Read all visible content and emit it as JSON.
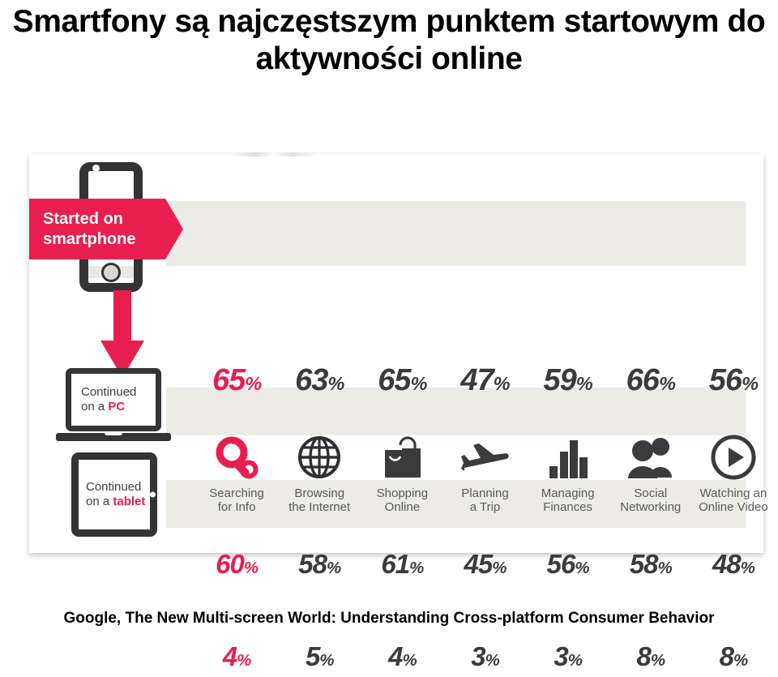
{
  "title": "Smartfony są najczęstszym punktem startowym do aktywności online",
  "source": "Google, The New Multi-screen World: Understanding Cross-platform Consumer Behavior",
  "colors": {
    "accent_pink": "#e81e4f",
    "dark_gray": "#343434",
    "band_gray": "#ecebe6",
    "label_gray": "#5a5a5a"
  },
  "devices": {
    "smartphone": {
      "line1": "Started on",
      "line2": "smartphone"
    },
    "pc": {
      "line1": "Continued",
      "line2_prefix": "on a ",
      "line2_highlight": "PC"
    },
    "tablet": {
      "line1": "Continued",
      "line2_prefix": "on a ",
      "line2_highlight": "tablet"
    }
  },
  "chart_data": {
    "type": "table",
    "title": "Smartfony są najczęstszym punktem startowym do aktywności online",
    "categories": [
      "Searching for Info",
      "Browsing the Internet",
      "Shopping Online",
      "Planning a Trip",
      "Managing Finances",
      "Social Networking",
      "Watching an Online Video"
    ],
    "series": [
      {
        "name": "Started on smartphone",
        "values": [
          65,
          63,
          65,
          47,
          59,
          66,
          56
        ],
        "unit": "%"
      },
      {
        "name": "Continued on a PC",
        "values": [
          60,
          58,
          61,
          45,
          56,
          58,
          48
        ],
        "unit": "%"
      },
      {
        "name": "Continued on a tablet",
        "values": [
          4,
          5,
          4,
          3,
          3,
          8,
          8
        ],
        "unit": "%"
      }
    ],
    "highlighted_column_index": 0,
    "xlabel": "",
    "ylabel": "",
    "legend_position": "left"
  },
  "activities": [
    {
      "icon": "magnifier-icon",
      "label_line1": "Searching",
      "label_line2": "for Info",
      "pct_started": "65",
      "pct_pc": "60",
      "pct_tablet": "4",
      "unit": "%",
      "accent": true
    },
    {
      "icon": "globe-icon",
      "label_line1": "Browsing",
      "label_line2": "the Internet",
      "pct_started": "63",
      "pct_pc": "58",
      "pct_tablet": "5",
      "unit": "%",
      "accent": false
    },
    {
      "icon": "shopping-bag-icon",
      "label_line1": "Shopping",
      "label_line2": "Online",
      "pct_started": "65",
      "pct_pc": "61",
      "pct_tablet": "4",
      "unit": "%",
      "accent": false
    },
    {
      "icon": "airplane-icon",
      "label_line1": "Planning",
      "label_line2": "a Trip",
      "pct_started": "47",
      "pct_pc": "45",
      "pct_tablet": "3",
      "unit": "%",
      "accent": false
    },
    {
      "icon": "bar-chart-icon",
      "label_line1": "Managing",
      "label_line2": "Finances",
      "pct_started": "59",
      "pct_pc": "56",
      "pct_tablet": "3",
      "unit": "%",
      "accent": false
    },
    {
      "icon": "people-icon",
      "label_line1": "Social",
      "label_line2": "Networking",
      "pct_started": "66",
      "pct_pc": "58",
      "pct_tablet": "8",
      "unit": "%",
      "accent": false
    },
    {
      "icon": "play-circle-icon",
      "label_line1": "Watching an",
      "label_line2": "Online Video",
      "pct_started": "56",
      "pct_pc": "48",
      "pct_tablet": "8",
      "unit": "%",
      "accent": false
    }
  ]
}
